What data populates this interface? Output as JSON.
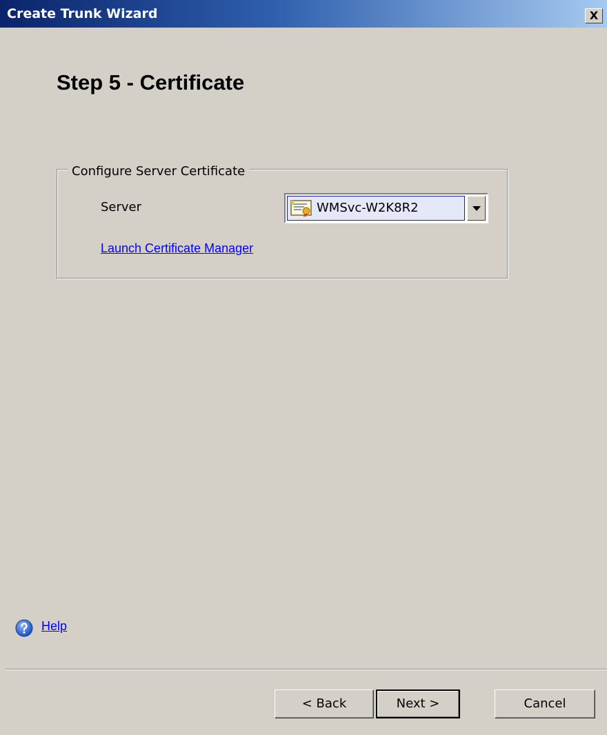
{
  "window": {
    "title": "Create Trunk Wizard",
    "close_label": "X"
  },
  "step": {
    "heading": "Step 5 - Certificate"
  },
  "certificate_group": {
    "legend": "Configure Server Certificate",
    "server_label": "Server",
    "server_selected": "WMSvc-W2K8R2",
    "server_icon": "certificate-icon",
    "launch_link": "Launch Certificate Manager"
  },
  "footer": {
    "help_icon": "help-icon",
    "help_label": "Help",
    "back_label": "< Back",
    "next_label": "Next >",
    "cancel_label": "Cancel"
  },
  "colors": {
    "titlebar_start": "#0a246a",
    "titlebar_end": "#a6caf0",
    "dialog_background": "#d4d0c8",
    "link": "#0000ff",
    "selection_background": "#e4e8f8",
    "selection_border": "#1b1bb8"
  }
}
